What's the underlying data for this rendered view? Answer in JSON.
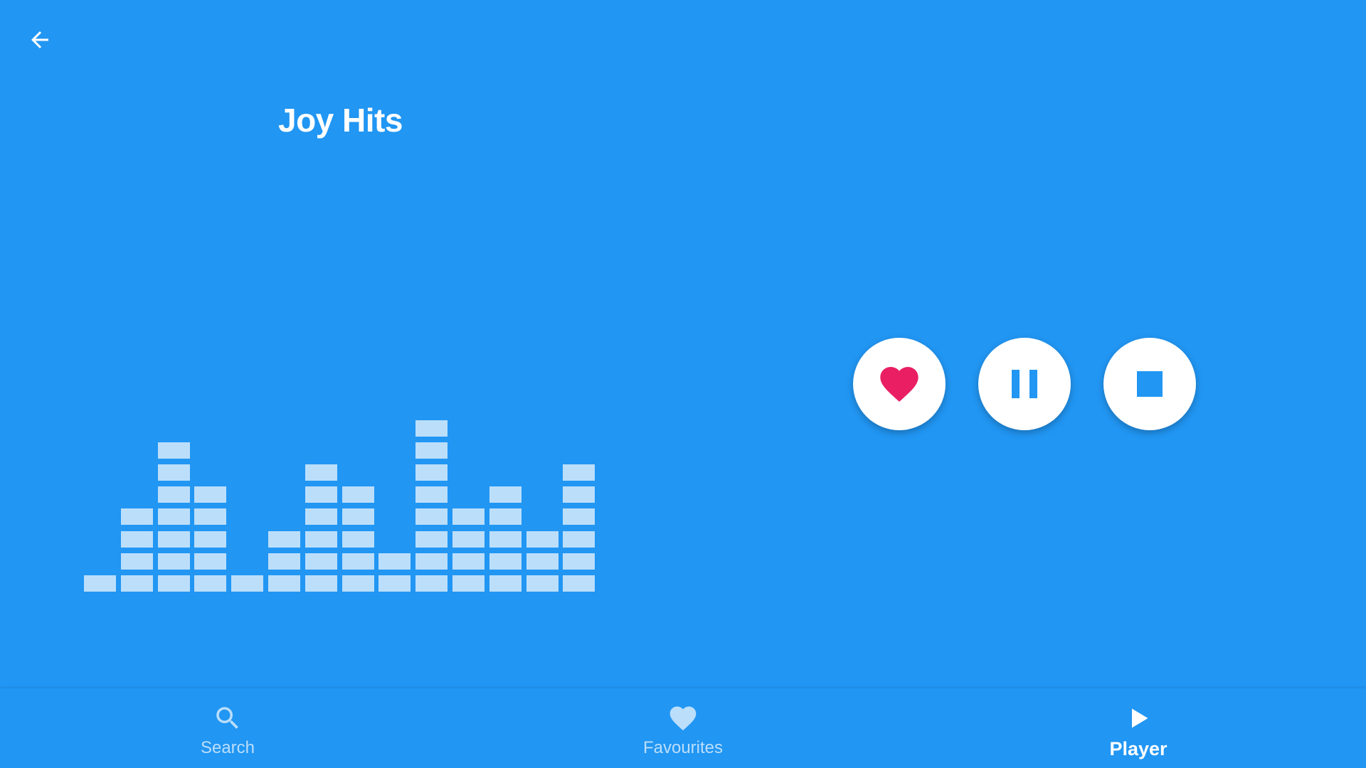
{
  "header": {
    "back_icon": "arrow-left-icon"
  },
  "station": {
    "title": "Joy Hits"
  },
  "equalizer": {
    "column_levels": [
      1,
      4,
      7,
      5,
      1,
      3,
      6,
      5,
      2,
      8,
      4,
      5,
      3,
      6
    ],
    "color": "#BBDEFB"
  },
  "controls": {
    "favourite_icon": "heart-icon",
    "pause_icon": "pause-icon",
    "stop_icon": "stop-icon",
    "heart_color": "#E91E63",
    "icon_color": "#2196F3"
  },
  "bottom_nav": {
    "items": [
      {
        "label": "Search",
        "icon": "search-icon",
        "active": false
      },
      {
        "label": "Favourites",
        "icon": "heart-icon",
        "active": false
      },
      {
        "label": "Player",
        "icon": "play-icon",
        "active": true
      }
    ]
  },
  "colors": {
    "background": "#2196F3",
    "accent": "#E91E63",
    "inactive": "#BBDEFB",
    "active": "#FFFFFF"
  }
}
